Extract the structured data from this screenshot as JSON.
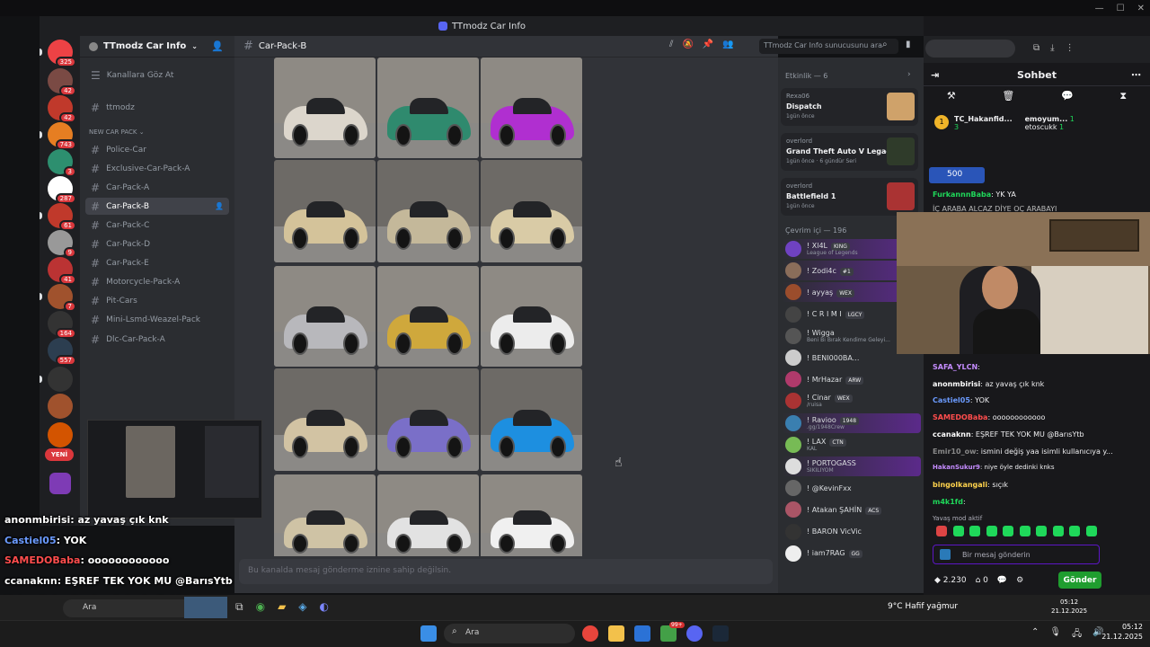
{
  "discord": {
    "window_title": "TTmodz Car Info",
    "server_name": "TTmodz Car Info",
    "browse_channels": "Kanallara Göz At",
    "first_channel": "ttmodz",
    "category": "NEW CAR PACK",
    "channels": [
      "Police-Car",
      "Exclusive-Car-Pack-A",
      "Car-Pack-A",
      "Car-Pack-B",
      "Car-Pack-C",
      "Car-Pack-D",
      "Car-Pack-E",
      "Motorcycle-Pack-A",
      "Pit-Cars",
      "Mini-Lsmd-Weazel-Pack",
      "Dlc-Car-Pack-A"
    ],
    "active_channel": "Car-Pack-B",
    "search_placeholder": "TTmodz Car Info sunucusunu ara",
    "message_placeholder": "Bu kanalda mesaj gönderme iznine sahip değilsin.",
    "rail_badges": [
      "325",
      "42",
      "42",
      "743",
      "3",
      "287",
      "61",
      "9",
      "41",
      "7",
      "164",
      "557"
    ],
    "new_label": "YENİ",
    "activity_header": "Etkinlik — 6",
    "activities": [
      {
        "user": "Rexa06",
        "title": "Dispatch",
        "sub": "1gün önce"
      },
      {
        "user": "overlord",
        "title": "Grand Theft Auto V Legacy",
        "sub": "1gün önce · 6 gündür Seri"
      },
      {
        "user": "overlord",
        "title": "Battlefield 1",
        "sub": "1gün önce"
      }
    ],
    "online_header": "Çevrim içi — 196",
    "members": [
      {
        "name": "! Xl4L",
        "tag": "KING",
        "sub": "League of Legends",
        "color": "#6f42c1"
      },
      {
        "name": "! Zodi4c",
        "tag": "#1",
        "sub": "",
        "color": "#8a6d5a"
      },
      {
        "name": "! ayyaş",
        "tag": "WEX",
        "sub": "",
        "color": "#9b4d2c"
      },
      {
        "name": "! C R I M I",
        "tag": "LGCY",
        "sub": "",
        "color": "#444"
      },
      {
        "name": "! Wigga",
        "tag": "",
        "sub": "Beni Bi Bırak Kendime Geleyi...",
        "color": "#555"
      },
      {
        "name": "! BENI000BA...",
        "tag": "",
        "sub": "",
        "color": "#ccc"
      },
      {
        "name": "! MrHazar",
        "tag": "ARW",
        "sub": "",
        "color": "#b03a6b"
      },
      {
        "name": "! Cinar",
        "tag": "WEX",
        "sub": "/ruisa",
        "color": "#a33"
      },
      {
        "name": "! Ravioo",
        "tag": "1948",
        "sub": ".gg/1948Crew",
        "color": "#3a7fb0"
      },
      {
        "name": "! LAX",
        "tag": "CTN",
        "sub": "KAL",
        "color": "#7b5"
      },
      {
        "name": "! PORTOGASS",
        "tag": "",
        "sub": "SIKILIYOM",
        "color": "#ddd"
      },
      {
        "name": "! @KevinFxx",
        "tag": "",
        "sub": "",
        "color": "#666"
      },
      {
        "name": "! Atakan ŞAHİN",
        "tag": "ACS",
        "sub": "",
        "color": "#a56"
      },
      {
        "name": "! BARON VicVic",
        "tag": "",
        "sub": "",
        "color": "#333"
      },
      {
        "name": "! iam7RAG",
        "tag": "GG",
        "sub": "",
        "color": "#eee"
      }
    ],
    "car_colors": [
      [
        "#dcd6cc",
        "#2f8a6e",
        "#b02fd0"
      ],
      [
        "#d4c39a",
        "#c4b89a",
        "#d9cba6"
      ],
      [
        "#b8b8bc",
        "#cfa83c",
        "#ececec"
      ],
      [
        "#d2c3a3",
        "#7a6fc8",
        "#1d8fe0"
      ],
      [
        "#cfc3a5",
        "#e2e2e2",
        "#f0f0f0"
      ]
    ]
  },
  "overlay_chat": [
    {
      "user": "anonmbirisi",
      "msg": ": az yavaş çık knk",
      "color": "#ffffff"
    },
    {
      "user": "Castiel05",
      "msg": ": YOK",
      "color": "#6b9bff"
    },
    {
      "user": "SAMEDOBaba",
      "msg": ": oooooooooooo",
      "color": "#ff4d4d"
    },
    {
      "user": "ccanaknn",
      "msg": ": EŞREF TEK YOK MU @BarısYtb",
      "color": "#ffffff"
    },
    {
      "user": "HakanSukur9",
      "msg": ": niye öyle dedinki knks",
      "color": "#c58cff"
    },
    {
      "user": "bingolkangali",
      "msg": ": sıçık",
      "color": "#ffd34d"
    },
    {
      "user": "m4k1fd",
      "msg": ":",
      "color": "#ffd34d"
    }
  ],
  "twitch": {
    "title": "Sohbet",
    "gift_user": "TC_Hakanfid...",
    "gift_count": "3",
    "top_user": "emoyum...",
    "top_count": "1",
    "second_user": "etoscukk",
    "second_count": "1",
    "bits_amount": "500",
    "pinned_user": "FurkannnBaba",
    "pinned_msg": ": YK YA",
    "behind_text": "İÇ ARABA ALCAZ DİYE OÇ ARABAYI",
    "messages": [
      {
        "user": "SAFA_YLCN",
        "msg": ":",
        "color": "#c58cff"
      },
      {
        "user": "anonmbirisi",
        "msg": ": az yavaş çık knk",
        "color": "#ffffff"
      },
      {
        "user": "Castiel05",
        "msg": ": YOK",
        "color": "#6b9bff"
      },
      {
        "user": "SAMEDOBaba",
        "msg": ": oooooooooooo",
        "color": "#ff4d4d"
      },
      {
        "user": "ccanaknn",
        "msg": ": EŞREF TEK YOK MU @BarısYtb",
        "color": "#ffffff"
      },
      {
        "user": "Emir10_ow",
        "msg": ": ismini değiş yaa isimli kullanıcıya y...",
        "color": "#888888"
      },
      {
        "user": "HakanSukur9",
        "msg": ": niye öyle dedinki knks",
        "color": "#c58cff"
      },
      {
        "user": "bingolkangali",
        "msg": ": sıçık",
        "color": "#ffd34d"
      },
      {
        "user": "m4k1fd",
        "msg": ":",
        "color": "#1fd85a"
      }
    ],
    "slow_mode": "Yavaş mod aktif",
    "input_placeholder": "Bir mesaj gönderin",
    "points": "2.230",
    "zero": "0",
    "send": "Gönder"
  },
  "inner_taskbar": {
    "search": "Ara",
    "weather": "9°C  Hafif yağmur",
    "time": "05:12",
    "date": "21.12.2025"
  },
  "taskbar": {
    "search": "Ara",
    "time": "05:12",
    "date": "21.12.2025",
    "badge": "99+"
  }
}
